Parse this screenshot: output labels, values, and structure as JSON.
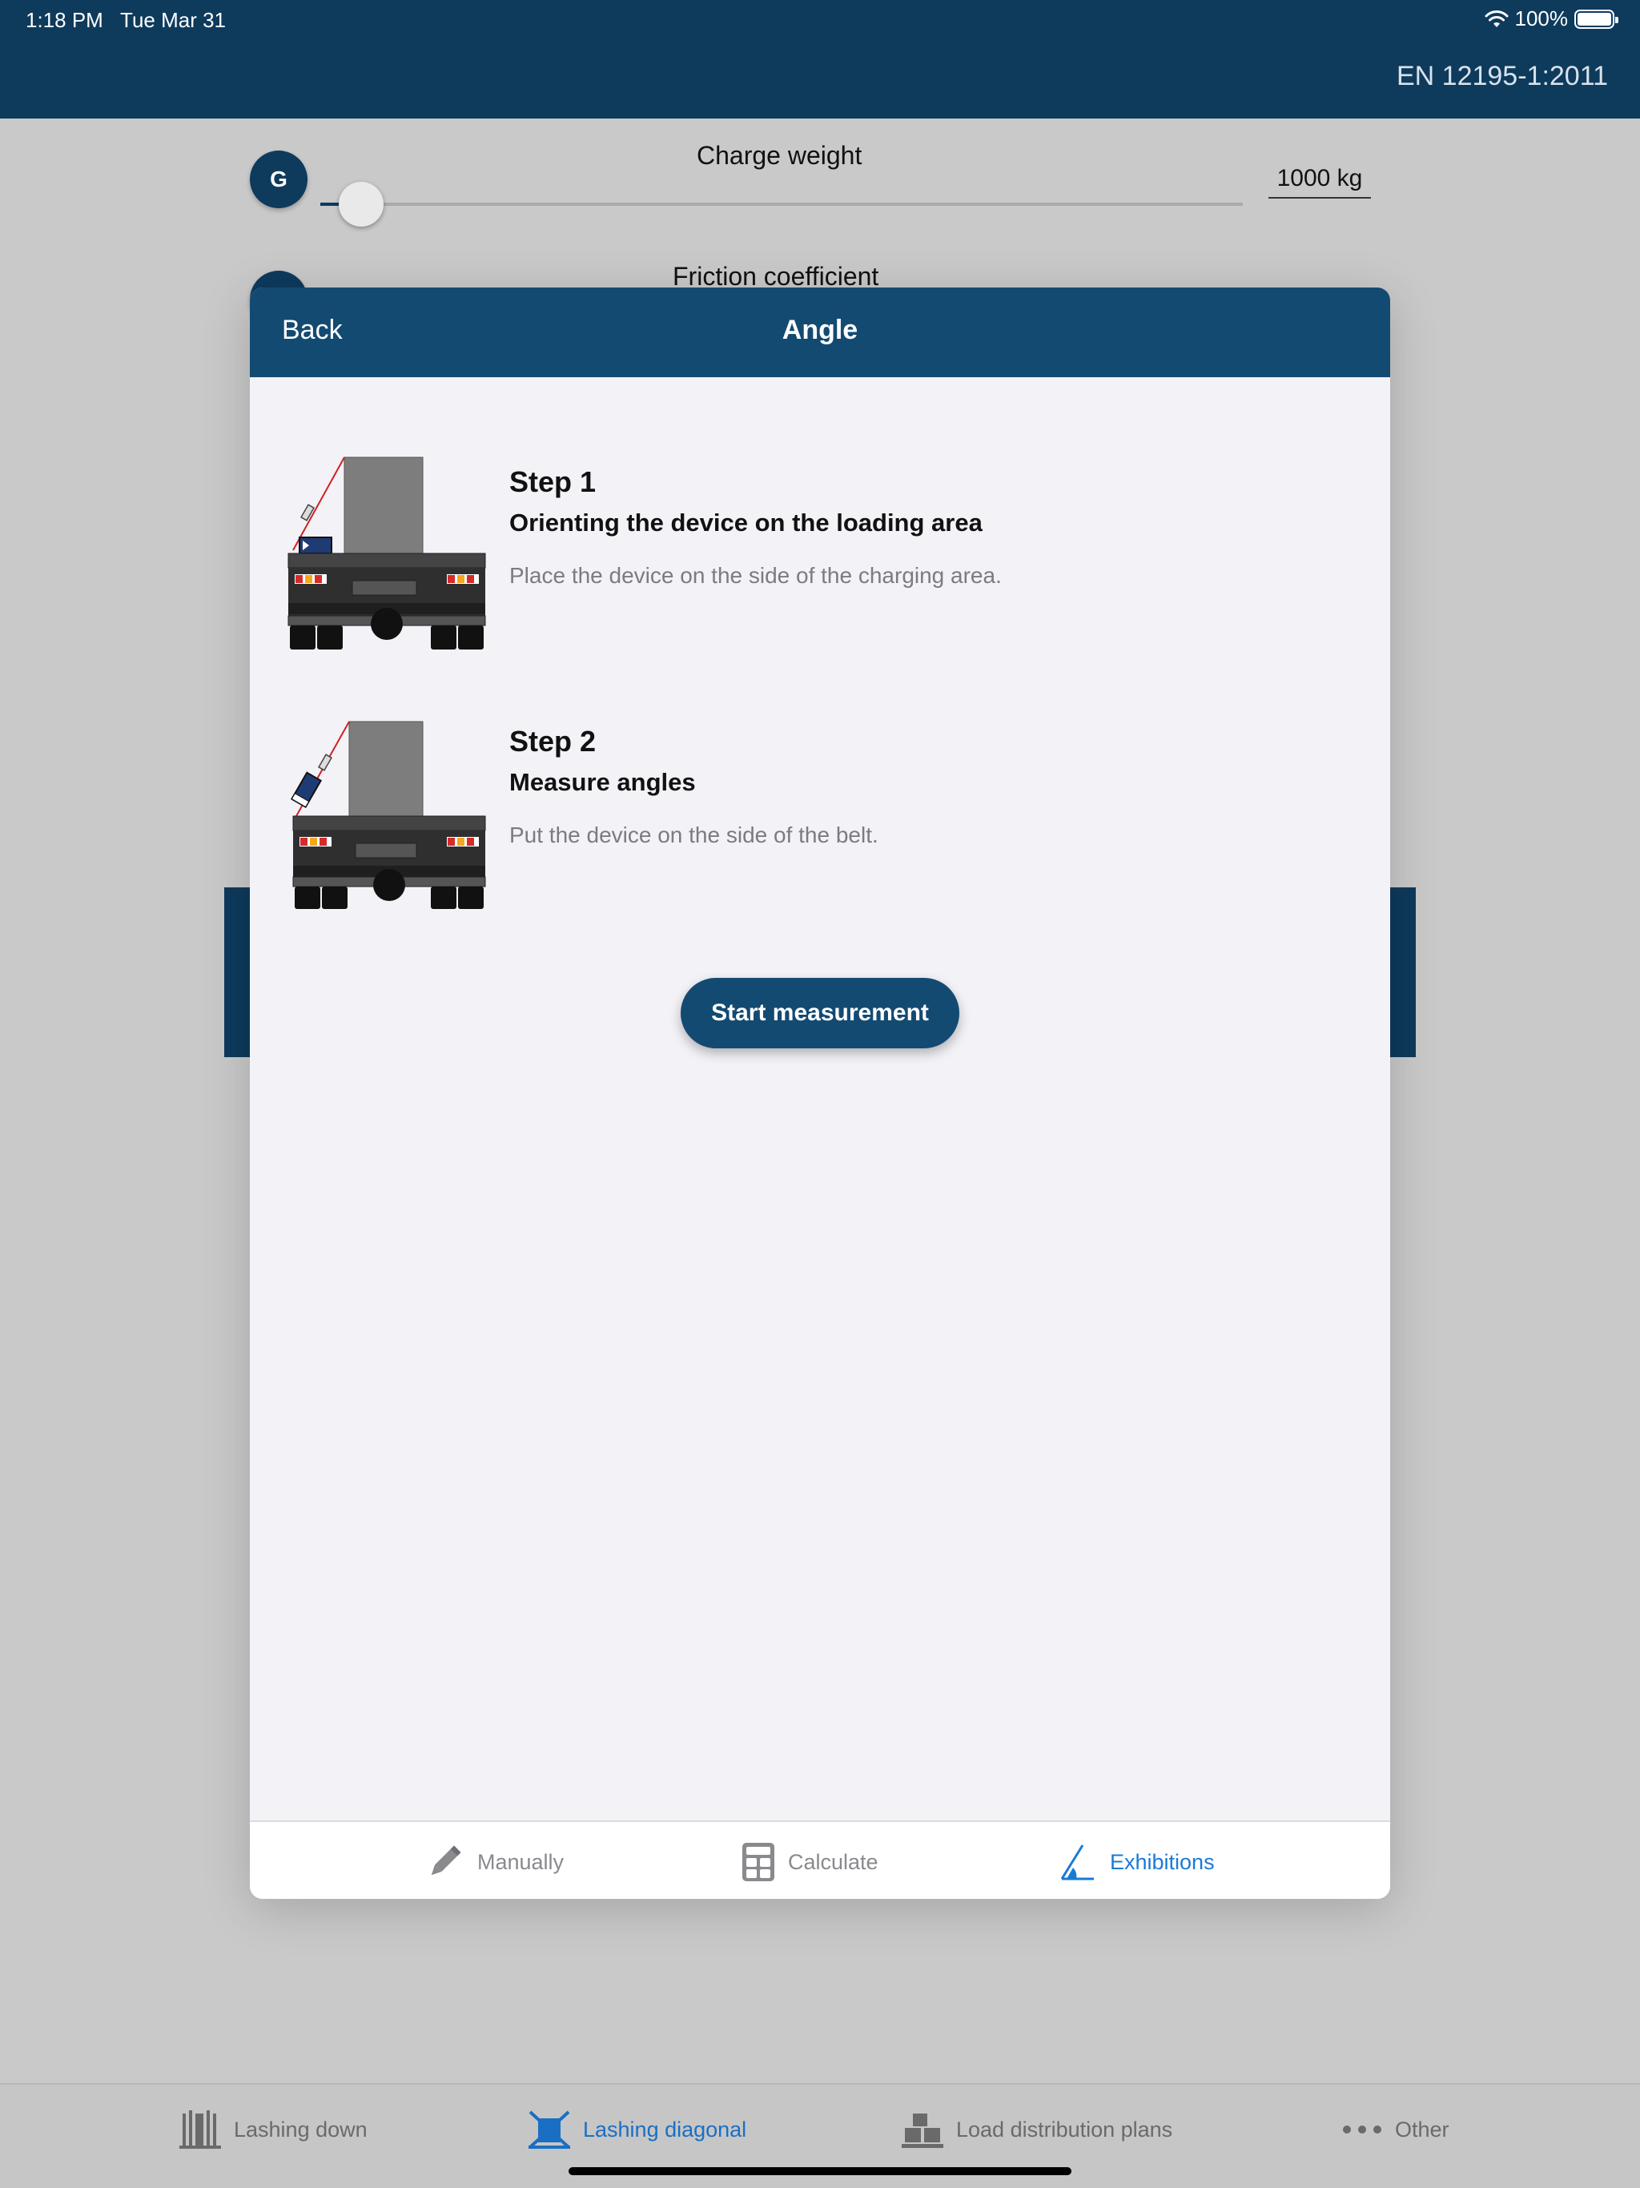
{
  "status_bar": {
    "time": "1:18 PM",
    "date": "Tue Mar 31",
    "battery": "100%"
  },
  "header": {
    "standard": "EN 12195-1:2011"
  },
  "background": {
    "charge_weight": {
      "badge": "G",
      "label": "Charge weight",
      "value": "1000  kg"
    },
    "friction": {
      "label": "Friction coefficient"
    }
  },
  "modal": {
    "back_label": "Back",
    "title": "Angle",
    "steps": [
      {
        "title": "Step 1",
        "subtitle": "Orienting the device on the loading area",
        "description": "Place the device on the side of the charging area."
      },
      {
        "title": "Step 2",
        "subtitle": "Measure angles",
        "description": "Put the device on the side of the belt."
      }
    ],
    "start_button": "Start measurement",
    "tabs": [
      {
        "label": "Manually",
        "icon": "pencil-icon",
        "active": false
      },
      {
        "label": "Calculate",
        "icon": "calculator-icon",
        "active": false
      },
      {
        "label": "Exhibitions",
        "icon": "angle-icon",
        "active": true
      }
    ]
  },
  "tabbar": {
    "items": [
      {
        "label": "Lashing down",
        "icon": "lashing-down-icon",
        "active": false
      },
      {
        "label": "Lashing diagonal",
        "icon": "lashing-diagonal-icon",
        "active": true
      },
      {
        "label": "Load distribution plans",
        "icon": "load-distribution-icon",
        "active": false
      },
      {
        "label": "Other",
        "icon": "more-dots-icon",
        "active": false
      }
    ]
  },
  "colors": {
    "primary": "#134a72",
    "accent_blue": "#1a7ad6",
    "red_belt": "#d22020"
  }
}
